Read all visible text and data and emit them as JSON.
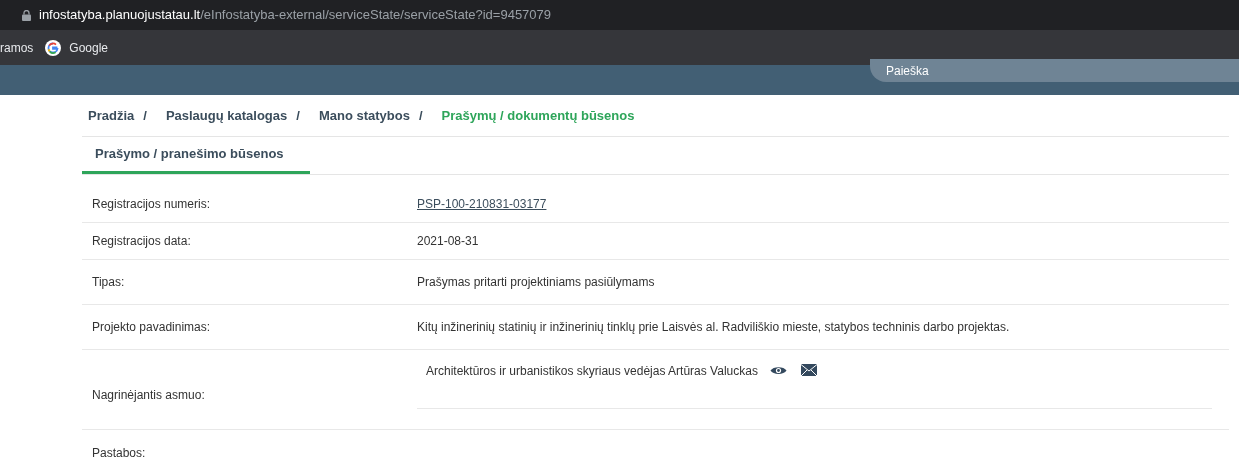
{
  "browser": {
    "url_host": "infostatyba.planuojustatau.lt",
    "url_path": "/eInfostatyba-external/serviceState/serviceState?id=9457079",
    "bookmarks": [
      "ramos",
      "Google"
    ]
  },
  "header": {
    "search": {
      "placeholder": "Paieška"
    }
  },
  "breadcrumbs": [
    {
      "label": "Pradžia",
      "current": false,
      "separator": "/"
    },
    {
      "label": "Paslaugų katalogas",
      "current": false,
      "separator": "/"
    },
    {
      "label": "Mano statybos",
      "current": false,
      "separator": "/"
    },
    {
      "label": "Prašymų / dokumentų būsenos",
      "current": true
    }
  ],
  "tabs": [
    {
      "label": "Prašymo / pranešimo būsenos",
      "selected": true
    }
  ],
  "rows": [
    {
      "label": "Registracijos numeris:",
      "kind": "link",
      "value": "PSP-100-210831-03177"
    },
    {
      "label": "Registracijos data:",
      "kind": "text",
      "value": "2021-08-31"
    },
    {
      "label": "Tipas:",
      "kind": "text",
      "value": "Prašymas pritarti projektiniams pasiūlymams"
    },
    {
      "label": "Projekto pavadinimas:",
      "kind": "text",
      "value": "Kitų inžinerinių statinių ir inžinerinių tinklų prie Laisvės al. Radviliškio mieste, statybos techninis darbo projektas."
    },
    {
      "label": "Nagrinėjantis asmuo:",
      "kind": "person",
      "value": "Architektūros ir urbanistikos skyriaus vedėjas Artūras Valuckas"
    },
    {
      "label": "Pastabos:",
      "kind": "empty"
    }
  ]
}
